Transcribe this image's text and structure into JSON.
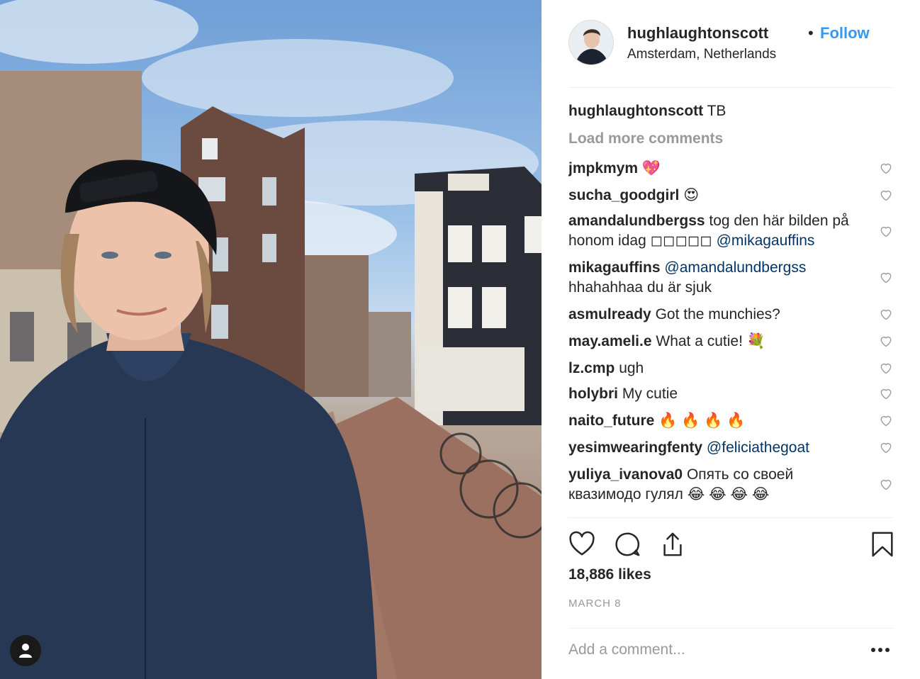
{
  "post": {
    "username": "hughlaughtonscott",
    "separator": "•",
    "follow_label": "Follow",
    "location": "Amsterdam, Netherlands",
    "caption_user": "hughlaughtonscott",
    "caption_text": "TB",
    "load_more_label": "Load more comments",
    "likes": "18,886 likes",
    "date": "MARCH 8",
    "add_comment_placeholder": "Add a comment..."
  },
  "comments": [
    {
      "user": "jmpkmym",
      "text": "",
      "emoji": "💖"
    },
    {
      "user": "sucha_goodgirl",
      "text": "",
      "emoji": "😍"
    },
    {
      "user": "amandalundbergss",
      "text": "tog den här bilden på honom idag ◻◻◻◻◻",
      "mention": "@mikagauffins"
    },
    {
      "user": "mikagauffins",
      "mention": "@amandalundbergss",
      "text2": "hhahahhaa du är sjuk"
    },
    {
      "user": "asmulready",
      "text": "Got the munchies?"
    },
    {
      "user": "may.ameli.e",
      "text": "What a cutie!",
      "emoji": "💐"
    },
    {
      "user": "lz.cmp",
      "text": "ugh"
    },
    {
      "user": "holybri",
      "text": "My cutie"
    },
    {
      "user": "naito_future",
      "text": "",
      "emoji": "🔥 🔥 🔥 🔥"
    },
    {
      "user": "yesimwearingfenty",
      "mention": "@feliciathegoat"
    },
    {
      "user": "yuliya_ivanova0",
      "text": "Опять со своей квазимодо гулял",
      "emoji": "😂 😂 😂 😂"
    }
  ],
  "colors": {
    "link": "#3897f0",
    "mention": "#003569",
    "muted": "#999999",
    "border": "#efefef"
  },
  "icons": [
    "heart-icon",
    "comment-icon",
    "share-icon",
    "bookmark-icon",
    "more-options-icon",
    "user-tag-icon"
  ]
}
